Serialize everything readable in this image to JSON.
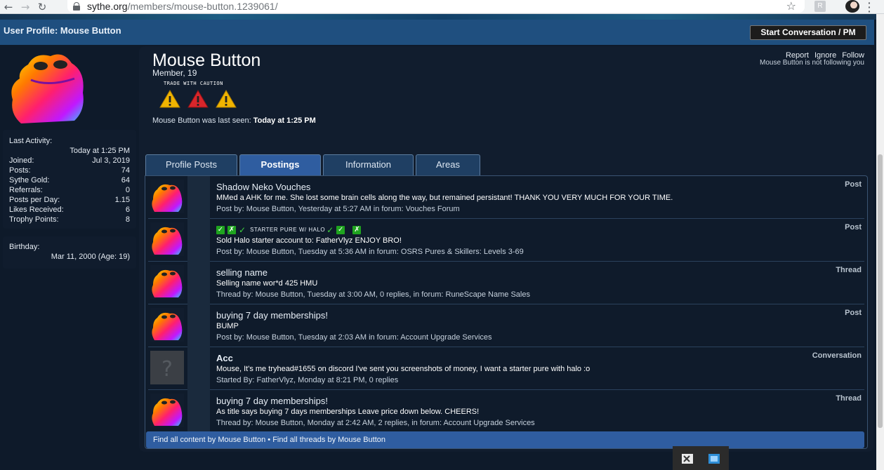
{
  "browser": {
    "url_host": "sythe.org",
    "url_path": "/members/mouse-button.1239061/",
    "extension_label": "R"
  },
  "header": {
    "page_title": "User Profile: Mouse Button",
    "start_conversation": "Start Conversation / PM"
  },
  "profile": {
    "name": "Mouse Button",
    "title": "Member, 19",
    "trade_label": "TRADE WITH CAUTION",
    "last_seen_prefix": "Mouse Button was last seen:",
    "last_seen_value": "Today at 1:25 PM",
    "actions": [
      "Report",
      "Ignore",
      "Follow"
    ],
    "follow_status": "Mouse Button is not following you"
  },
  "sidebar": {
    "last_activity_label": "Last Activity:",
    "last_activity_value": "Today at 1:25 PM",
    "stats": [
      {
        "label": "Joined:",
        "value": "Jul 3, 2019"
      },
      {
        "label": "Posts:",
        "value": "74"
      },
      {
        "label": "Sythe Gold:",
        "value": "64"
      },
      {
        "label": "Referrals:",
        "value": "0"
      },
      {
        "label": "Posts per Day:",
        "value": "1.15"
      },
      {
        "label": "Likes Received:",
        "value": "6"
      },
      {
        "label": "Trophy Points:",
        "value": "8"
      }
    ],
    "birthday_label": "Birthday:",
    "birthday_value": "Mar 11, 2000 (Age: 19)"
  },
  "tabs": [
    {
      "label": "Profile Posts",
      "active": false
    },
    {
      "label": "Postings",
      "active": true
    },
    {
      "label": "Information",
      "active": false
    },
    {
      "label": "Areas",
      "active": false
    }
  ],
  "postings": [
    {
      "title": "Shadow Neko Vouches",
      "snippet": "MMed a AHK for me. She lost some brain cells along the way, but remained persistant! THANK YOU VERY MUCH FOR YOUR TIME.",
      "meta": "Post by: Mouse Button, Yesterday at 5:27 AM in forum: Vouches Forum",
      "type": "Post"
    },
    {
      "title": "STARTER PURE W/ HALO",
      "snippet": "Sold Halo starter account to: FatherVlyz ENJOY BRO!",
      "meta": "Post by: Mouse Button, Tuesday at 5:36 AM in forum: OSRS Pures & Skillers: Levels 3-69",
      "type": "Post"
    },
    {
      "title": "selling name",
      "snippet": "Selling name wor*d 425 HMU",
      "meta": "Thread by: Mouse Button, Tuesday at 3:00 AM, 0 replies, in forum: RuneScape Name Sales",
      "type": "Thread"
    },
    {
      "title": "buying 7 day memberships!",
      "snippet": "BUMP",
      "meta": "Post by: Mouse Button, Tuesday at 2:03 AM in forum: Account Upgrade Services",
      "type": "Post"
    },
    {
      "title": "Acc",
      "snippet": "Mouse, It's me tryhead#1655 on discord I've sent you screenshots of money, I want a starter pure with halo :o",
      "meta": "Started By: FatherVlyz, Monday at 8:21 PM, 0 replies",
      "type": "Conversation"
    },
    {
      "title": "buying 7 day memberships!",
      "snippet": "As title says buying 7 days memberships Leave price down below. CHEERS!",
      "meta": "Thread by: Mouse Button, Monday at 2:42 AM, 2 replies, in forum: Account Upgrade Services",
      "type": "Thread"
    }
  ],
  "footer_links": {
    "find_content": "Find all content by Mouse Button",
    "separator": "•",
    "find_threads": "Find all threads by Mouse Button"
  },
  "icons": {
    "back": "back-arrow-icon",
    "forward": "forward-arrow-icon",
    "reload": "reload-icon",
    "lock": "lock-icon",
    "bookmark": "star-icon",
    "warning": "warning-triangle-icon",
    "check": "check-icon"
  },
  "colors": {
    "header_bar": "#1f4f7f",
    "tab_active": "#2f5da0",
    "panel_bg": "#111d2e",
    "warning_yellow": "#f0b400",
    "warning_red": "#d9262b"
  }
}
